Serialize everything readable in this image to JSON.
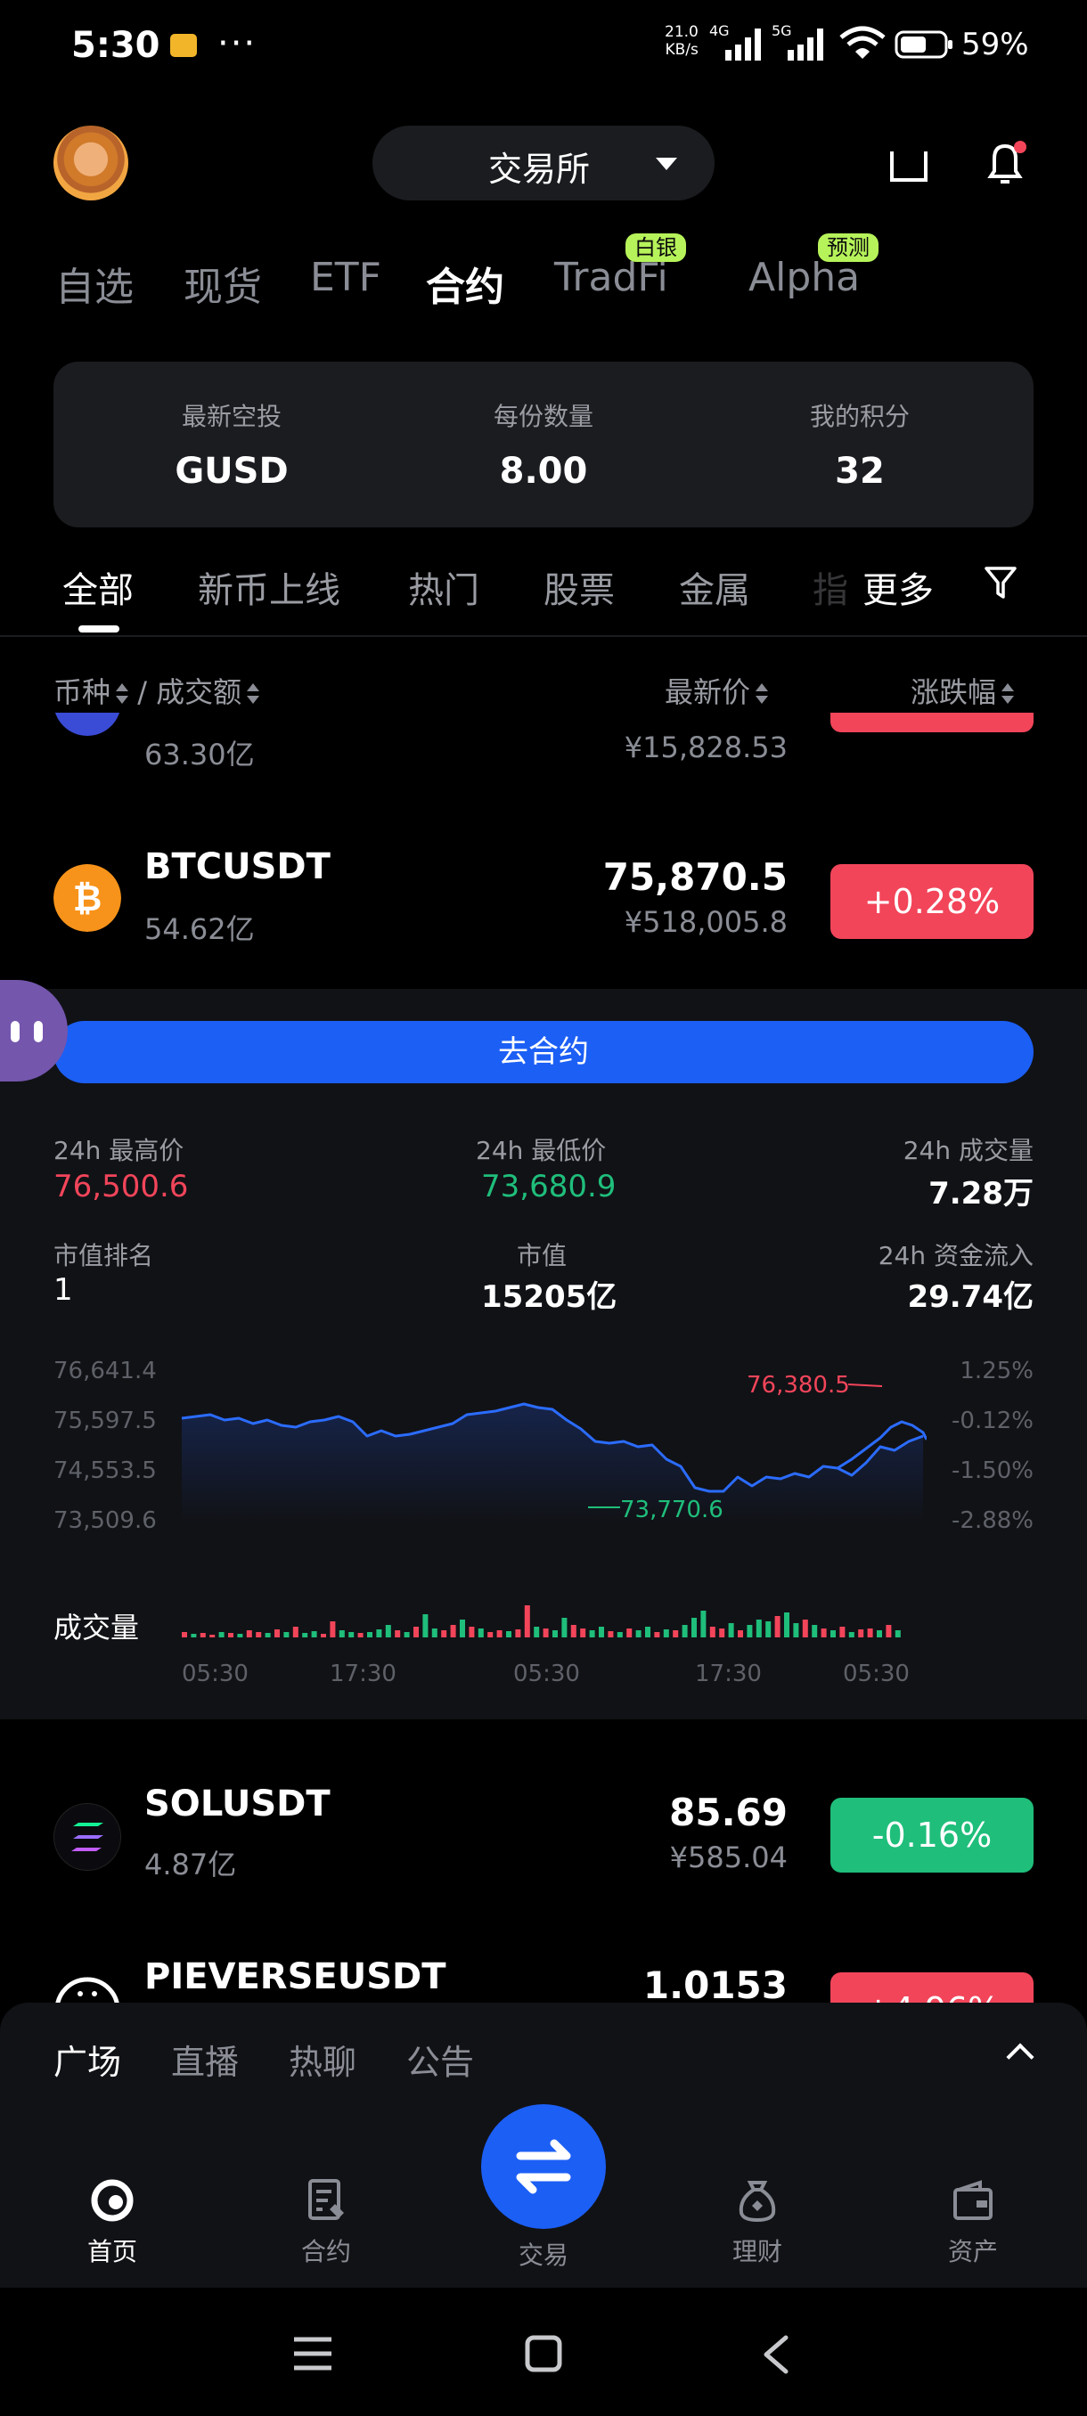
{
  "status_bar": {
    "time": "5:30",
    "dots": "···",
    "net_speed": "21.0",
    "net_unit": "KB/s",
    "sig1": "4G",
    "sig2": "5G",
    "battery": "59%"
  },
  "header": {
    "exchange_label": "交易所"
  },
  "market_tabs": [
    {
      "label": "自选"
    },
    {
      "label": "现货"
    },
    {
      "label": "ETF"
    },
    {
      "label": "合约"
    },
    {
      "label": "TradFi",
      "badge": "白银"
    },
    {
      "label": "Alpha",
      "badge": "预测"
    }
  ],
  "airdrop": [
    {
      "key": "最新空投",
      "value": "GUSD"
    },
    {
      "key": "每份数量",
      "value": "8.00"
    },
    {
      "key": "我的积分",
      "value": "32"
    }
  ],
  "category_tabs": [
    "全部",
    "新币上线",
    "热门",
    "股票",
    "金属",
    "指",
    "更多"
  ],
  "columns": {
    "coin": "币种",
    "sep": " / ",
    "volume": "成交额",
    "price": "最新价",
    "change": "涨跌幅"
  },
  "rows": {
    "partial_top": {
      "volume": "63.30亿",
      "cny": "¥15,828.53"
    },
    "btc": {
      "symbol": "BTCUSDT",
      "volume": "54.62亿",
      "price": "75,870.5",
      "cny": "¥518,005.8",
      "change": "+0.28%"
    },
    "sol": {
      "symbol": "SOLUSDT",
      "volume": "4.87亿",
      "price": "85.69",
      "cny": "¥585.04",
      "change": "-0.16%"
    },
    "pieverse": {
      "symbol": "PIEVERSEUSDT",
      "price": "1.0153",
      "change": "+4.96%"
    }
  },
  "panel": {
    "go_button": "去合约",
    "stats": {
      "high_k": "24h 最高价",
      "high_v": "76,500.6",
      "low_k": "24h 最低价",
      "low_v": "73,680.9",
      "vol_k": "24h 成交量",
      "vol_v": "7.28万",
      "rank_k": "市值排名",
      "rank_v": "1",
      "mcap_k": "市值",
      "mcap_v": "15205亿",
      "flow_k": "24h 资金流入",
      "flow_v": "29.74亿"
    },
    "axis_left": [
      "76,641.4",
      "75,597.5",
      "74,553.5",
      "73,509.6"
    ],
    "axis_right": [
      "1.25%",
      "-0.12%",
      "-1.50%",
      "-2.88%"
    ],
    "high_marker": "76,380.5",
    "low_marker": "73,770.6",
    "volume_label": "成交量",
    "time_labels": [
      "05:30",
      "17:30",
      "05:30",
      "17:30",
      "05:30"
    ]
  },
  "colors": {
    "up": "#f2455a",
    "down": "#1fbe7b",
    "accent": "#1c5ff5",
    "badge": "#b6f35a"
  },
  "bottom_tabs": [
    "广场",
    "直播",
    "热聊",
    "公告"
  ],
  "nav": [
    {
      "label": "首页",
      "icon": "home-icon"
    },
    {
      "label": "合约",
      "icon": "contract-icon"
    },
    {
      "label": "交易",
      "icon": "trade-icon"
    },
    {
      "label": "理财",
      "icon": "earn-icon"
    },
    {
      "label": "资产",
      "icon": "wallet-icon"
    }
  ]
}
